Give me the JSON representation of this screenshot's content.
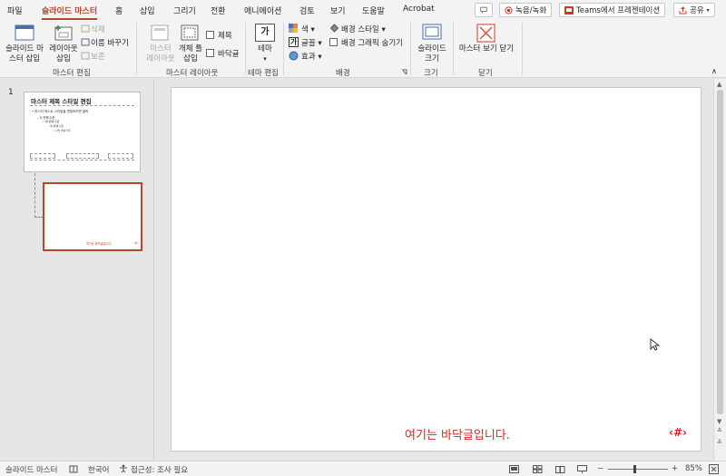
{
  "tabs": [
    "파일",
    "슬라이드 마스터",
    "홈",
    "삽입",
    "그리기",
    "전환",
    "애니메이션",
    "검토",
    "보기",
    "도움말",
    "Acrobat"
  ],
  "top_buttons": {
    "record": "녹음/녹화",
    "teams": "Teams에서 프레젠테이션",
    "share": "공유"
  },
  "ribbon": {
    "insert_master": "슬라이드 마\n스터 삽입",
    "insert_layout": "레이아웃\n삽입",
    "delete": "삭제",
    "rename": "이름 바꾸기",
    "preserve": "보존",
    "group_master_edit": "마스터 편집",
    "master_layout": "마스터\n레이아웃",
    "insert_placeholder": "개체 틀\n삽입",
    "title_check": "제목",
    "footer_check": "바닥글",
    "group_master_layout": "마스터 레이아웃",
    "theme": "테마",
    "group_theme_edit": "테마 편집",
    "colors": "색",
    "fonts": "글꼴",
    "effects": "효과",
    "bg_styles": "배경 스타일",
    "hide_bg": "배경 그래픽 숨기기",
    "group_background": "배경",
    "slide_size": "슬라이드\n크기",
    "group_size": "크기",
    "close_master": "마스터 보기 닫기",
    "group_close": "닫기"
  },
  "thumbnails": {
    "slide_number": "1",
    "master_title": "마스터 제목 스타일 편집",
    "master_text": "• 마스터 텍스트 스타일을 편집하려면 클릭",
    "level2": "– 두 번째 수준",
    "level3": "• 세 번째 수준",
    "level4": "– 네 번째 수준",
    "level5": "» 다섯 번째 수준",
    "layout_footer": "여기는 바닥글입니다."
  },
  "slide": {
    "footer_text": "여기는 바닥글입니다.",
    "slide_number_field": "‹#›"
  },
  "status": {
    "view": "슬라이드 마스터",
    "language": "한국어",
    "accessibility": "접근성: 조사 필요",
    "zoom": "85%"
  },
  "colors": {
    "accent": "#b7472a",
    "footer_red": "#e02020"
  }
}
